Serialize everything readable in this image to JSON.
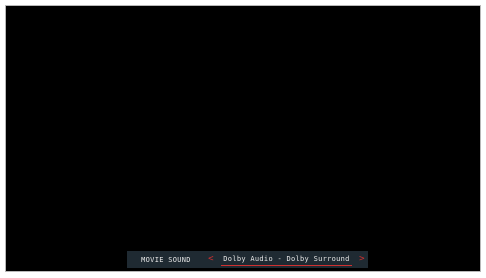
{
  "osd": {
    "setting_label": "MOVIE SOUND",
    "value": "Dolby Audio - Dolby Surround",
    "prev_glyph": "<",
    "next_glyph": ">"
  },
  "colors": {
    "screen": "#000000",
    "bar": "#1f2a32",
    "accent": "#d03030",
    "text": "#e6e6e6"
  }
}
